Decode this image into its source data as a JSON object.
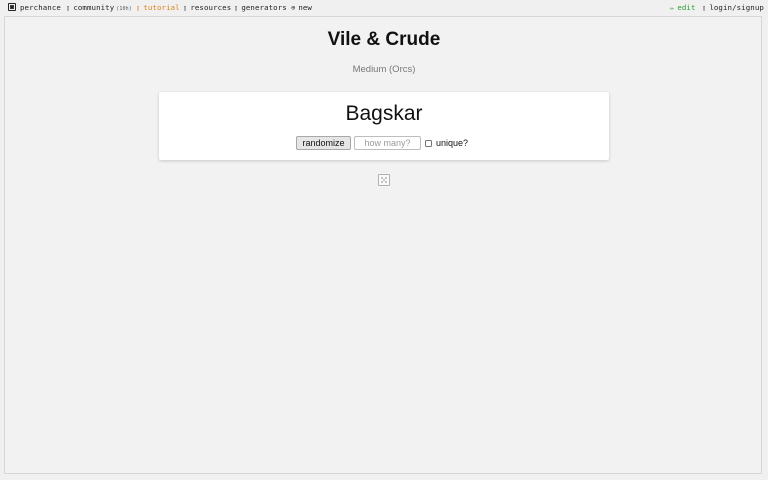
{
  "nav": {
    "brand": "perchance",
    "community": "community",
    "community_count": "(10h)",
    "tutorial": "tutorial",
    "resources": "resources",
    "generators": "generators",
    "new": "new",
    "edit": "edit",
    "login": "login/signup"
  },
  "icons": {
    "brand": "dice-icon",
    "community": "chat-icon",
    "tutorial": "book-icon",
    "resources": "book-icon",
    "generators": "book-icon",
    "new": "plus-circle-icon",
    "edit": "pencil-icon",
    "login": "person-icon"
  },
  "colors": {
    "tutorial": "#e0801a",
    "edit": "#2d9a2d"
  },
  "main": {
    "title": "Vile & Crude",
    "subtitle": "Medium (Orcs)",
    "result": "Bagskar",
    "randomize_label": "randomize",
    "howmany_placeholder": "how many?",
    "unique_label": "unique?",
    "unique_checked": false
  }
}
